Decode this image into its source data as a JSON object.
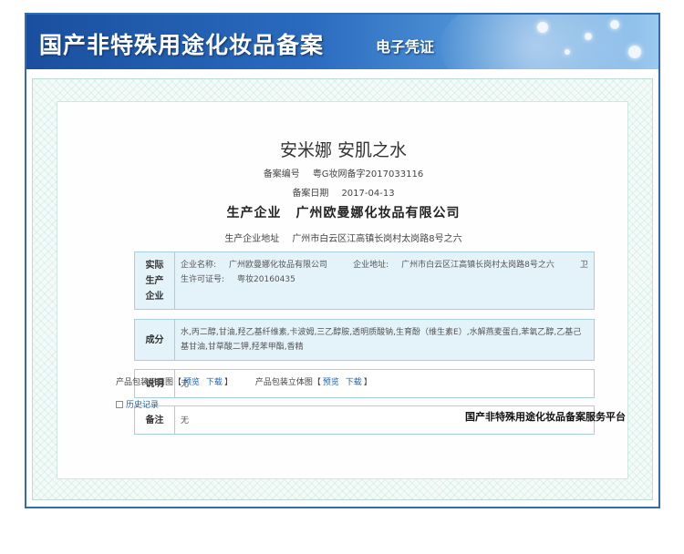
{
  "banner": {
    "title": "国产非特殊用途化妆品备案",
    "subtitle": "电子凭证"
  },
  "product": {
    "name": "安米娜 安肌之水",
    "record_no_label": "备案编号",
    "record_no": "粤G妆网备字2017033116",
    "record_date_label": "备案日期",
    "record_date": "2017-04-13"
  },
  "company": {
    "label": "生产企业",
    "name": "广州欧曼娜化妆品有限公司",
    "address_label": "生产企业地址",
    "address": "广州市白云区江高镇长岗村太岗路8号之六"
  },
  "sections": {
    "enterprise": {
      "head": "实际生产企业",
      "name_label": "企业名称:",
      "name": "广州欧曼娜化妆品有限公司",
      "addr_label": "企业地址:",
      "addr": "广州市白云区江高镇长岗村太岗路8号之六",
      "license_label": "卫生许可证号:",
      "license": "粤妆20160435"
    },
    "ingredients": {
      "head": "成分",
      "text": "水,丙二醇,甘油,羟乙基纤维素,卡波姆,三乙醇胺,透明质酸钠,生育酚（维生素E）,水解燕麦蛋白,苯氧乙醇,乙基己基甘油,甘草酸二钾,羟苯甲酯,香精"
    },
    "notes": {
      "head": "说明",
      "text": "无"
    },
    "remarks": {
      "head": "备注",
      "text": "无"
    }
  },
  "links": {
    "flat_label": "产品包装平面图",
    "solid_label": "产品包装立体图",
    "preview": "预览",
    "download": "下载",
    "lbracket": "【",
    "rbracket": "】",
    "history": "历史记录"
  },
  "footer": {
    "platform": "国产非特殊用途化妆品备案服务平台"
  }
}
